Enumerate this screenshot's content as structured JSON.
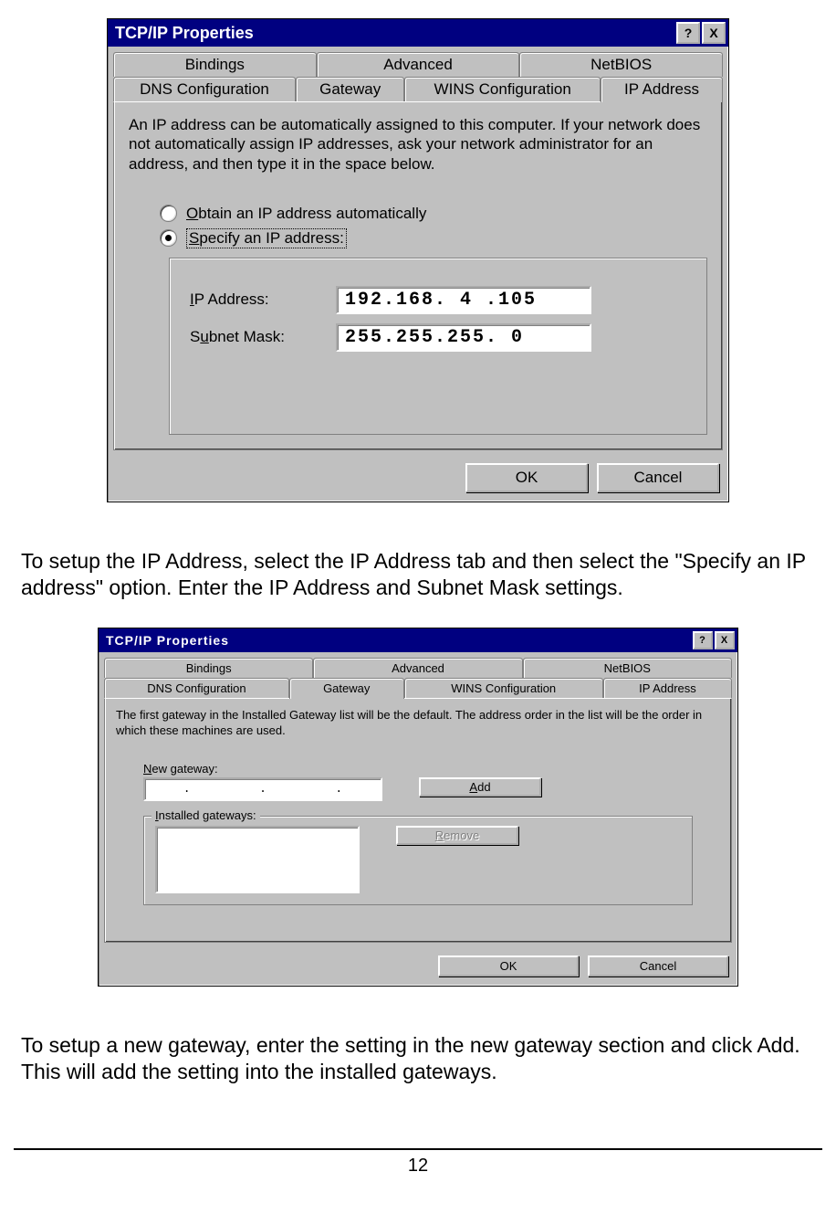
{
  "dialog1": {
    "title": "TCP/IP Properties",
    "help_glyph": "?",
    "close_glyph": "X",
    "tabs_row1": [
      "Bindings",
      "Advanced",
      "NetBIOS"
    ],
    "tabs_row2": [
      "DNS Configuration",
      "Gateway",
      "WINS Configuration",
      "IP Address"
    ],
    "active_tab": "IP Address",
    "info": "An IP address can be automatically assigned to this computer. If your network does not automatically assign IP addresses, ask your network administrator for an address, and then type it in the space below.",
    "radio_obtain": "Obtain an IP address automatically",
    "radio_obtain_ul": "O",
    "radio_specify": "Specify an IP address:",
    "radio_specify_ul": "S",
    "ip_label": "IP Address:",
    "ip_label_ul": "I",
    "ip_value": "192.168.  4 .105",
    "mask_label": "Subnet Mask:",
    "mask_label_ul": "u",
    "mask_value": "255.255.255.  0",
    "ok": "OK",
    "cancel": "Cancel"
  },
  "para1": "To setup the IP Address, select the IP Address tab and then select the \"Specify an IP address\" option.  Enter the IP Address and Subnet Mask settings.",
  "dialog2": {
    "title": "TCP/IP Properties",
    "help_glyph": "?",
    "close_glyph": "X",
    "tabs_row1": [
      "Bindings",
      "Advanced",
      "NetBIOS"
    ],
    "tabs_row2": [
      "DNS Configuration",
      "Gateway",
      "WINS Configuration",
      "IP Address"
    ],
    "active_tab": "Gateway",
    "info": "The first gateway in the Installed Gateway list will be the default. The address order in the list will be the order in which these machines are used.",
    "new_gw_label": "New gateway:",
    "new_gw_ul": "N",
    "add": "Add",
    "add_ul": "A",
    "installed_label": "Installed gateways:",
    "installed_ul": "I",
    "remove": "Remove",
    "remove_ul": "R",
    "ok": "OK",
    "cancel": "Cancel"
  },
  "para2": "To setup a new gateway, enter the setting in the new gateway section and click Add.  This will add the setting into the installed gateways.",
  "page_number": "12"
}
